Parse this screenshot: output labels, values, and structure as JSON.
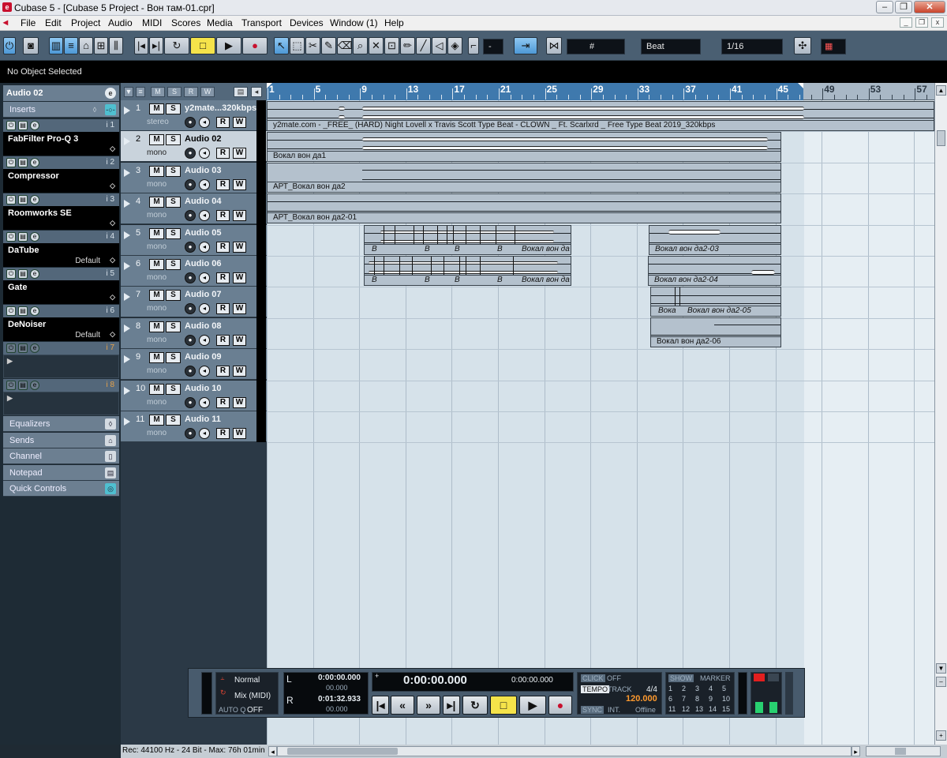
{
  "window": {
    "title": "Cubase 5 - [Cubase 5 Project - Вон там-01.cpr]",
    "app_icon": "cubase-icon"
  },
  "menu": [
    "File",
    "Edit",
    "Project",
    "Audio",
    "MIDI",
    "Scores",
    "Media",
    "Transport",
    "Devices",
    "Window (1)",
    "Help"
  ],
  "toolbar": {
    "quantize_mode": "-",
    "snap_type": "Beat",
    "grid_value": "1/16",
    "accent": "#4d98d6"
  },
  "infoline": {
    "text": "No Object Selected"
  },
  "inspector": {
    "track_name": "Audio 02",
    "inserts_label": "Inserts",
    "slots": [
      {
        "index": "i 1",
        "plugin": "FabFilter Pro-Q 3",
        "preset": ""
      },
      {
        "index": "i 2",
        "plugin": "Compressor",
        "preset": ""
      },
      {
        "index": "i 3",
        "plugin": "Roomworks SE",
        "preset": ""
      },
      {
        "index": "i 4",
        "plugin": "DaTube",
        "preset": "Default"
      },
      {
        "index": "i 5",
        "plugin": "Gate",
        "preset": ""
      },
      {
        "index": "i 6",
        "plugin": "DeNoiser",
        "preset": "Default"
      },
      {
        "index": "i 7",
        "plugin": "",
        "preset": ""
      },
      {
        "index": "i 8",
        "plugin": "",
        "preset": ""
      }
    ],
    "sections": [
      "Equalizers",
      "Sends",
      "Channel",
      "Notepad",
      "Quick Controls"
    ]
  },
  "tracks": [
    {
      "num": "1",
      "name": "y2mate...320kbps",
      "channel": "stereo"
    },
    {
      "num": "2",
      "name": "Audio 02",
      "channel": "mono",
      "selected": true
    },
    {
      "num": "3",
      "name": "Audio 03",
      "channel": "mono"
    },
    {
      "num": "4",
      "name": "Audio 04",
      "channel": "mono"
    },
    {
      "num": "5",
      "name": "Audio 05",
      "channel": "mono"
    },
    {
      "num": "6",
      "name": "Audio 06",
      "channel": "mono"
    },
    {
      "num": "7",
      "name": "Audio 07",
      "channel": "mono"
    },
    {
      "num": "8",
      "name": "Audio 08",
      "channel": "mono"
    },
    {
      "num": "9",
      "name": "Audio 09",
      "channel": "mono"
    },
    {
      "num": "10",
      "name": "Audio 10",
      "channel": "mono"
    },
    {
      "num": "11",
      "name": "Audio 11",
      "channel": "mono"
    }
  ],
  "ruler": [
    "1",
    "5",
    "9",
    "13",
    "17",
    "21",
    "25",
    "29",
    "33",
    "37",
    "41",
    "45",
    "49",
    "53",
    "57"
  ],
  "clips": {
    "c1": "y2mate.com - _FREE_ (HARD) Night Lovell x Travis Scott Type Beat - CLOWN _ Ft. Scarlxrd _ Free Type Beat 2019_320kbps",
    "c2": "Вокал вон да1",
    "c3": "АРТ_Вокал вон да2",
    "c4": "АРТ_Вокал вон да2-01",
    "c5a_frag": [
      "В",
      "В",
      "В",
      "В"
    ],
    "c5a": "Вокал вон да",
    "c5b": "Вокал вон да2-03",
    "c6a_frag": [
      "В",
      "В",
      "В",
      "В"
    ],
    "c6a": "Вокал вон да",
    "c6b": "Вокал вон да2-04",
    "c7a": "Вока",
    "c7b": "Вокал вон да2-05",
    "c8": "Вокал вон да2-06"
  },
  "transport": {
    "mode": "Normal",
    "mix_mode": "Mix (MIDI)",
    "auto_q_label": "AUTO Q",
    "auto_q": "OFF",
    "left_locator": "0:00:00.000",
    "left_sub": "00.000",
    "right_locator": "0:01:32.933",
    "right_sub": "00.000",
    "primary_time": "0:00:00.000",
    "secondary_time": "0:00:00.000",
    "click_label": "CLICK",
    "click": "OFF",
    "tempo_label": "TEMPO",
    "track_label": "TRACK",
    "signature": "4/4",
    "tempo": "120.000",
    "sync_label": "SYNC",
    "sync_src": "INT.",
    "sync_state": "Offline",
    "show_label": "SHOW",
    "marker_label": "MARKER",
    "markers": [
      "1",
      "2",
      "3",
      "4",
      "5",
      "6",
      "7",
      "8",
      "9",
      "10",
      "11",
      "12",
      "13",
      "14",
      "15"
    ],
    "tempo_color": "#ff9a2e"
  },
  "status": {
    "text": "Rec: 44100 Hz - 24 Bit - Max: 76h 01min"
  }
}
